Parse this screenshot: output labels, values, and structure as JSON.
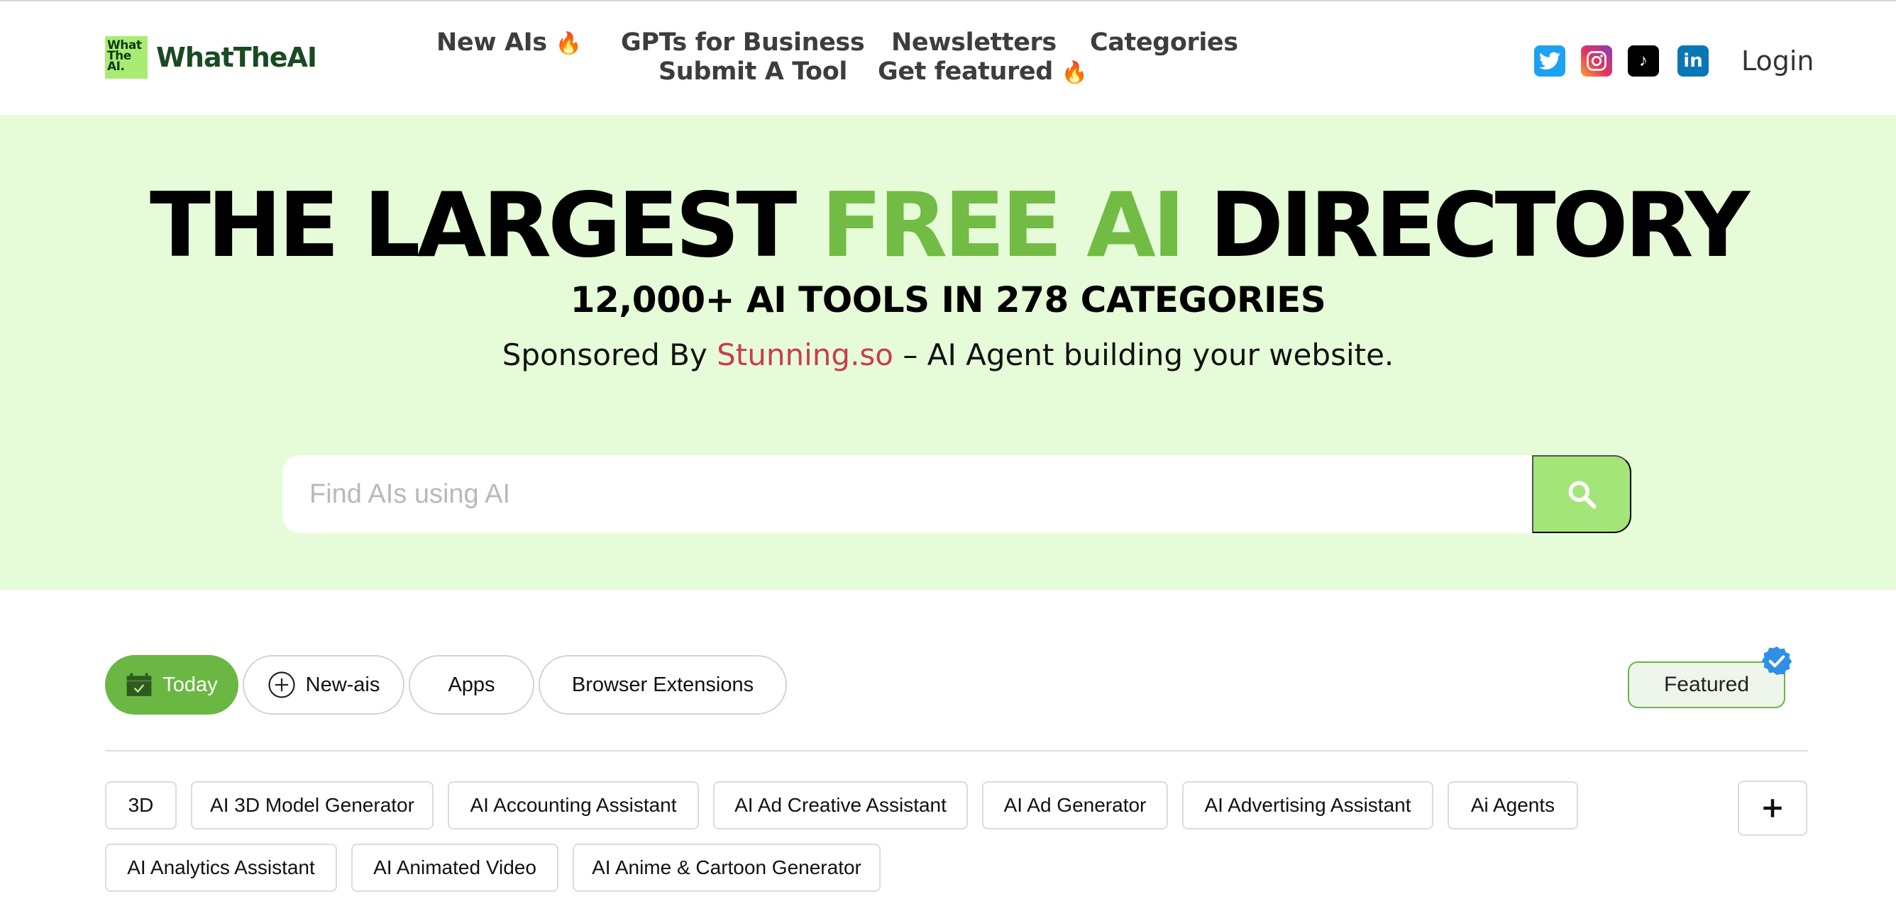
{
  "header": {
    "logo_badge_lines": [
      "What",
      "The",
      "AI."
    ],
    "logo_text": "WhatTheAI",
    "nav": {
      "new_ais": "New AIs",
      "gpts_business": "GPTs for Business",
      "newsletters": "Newsletters",
      "categories": "Categories",
      "submit_tool": "Submit A Tool",
      "get_featured": "Get featured"
    },
    "fire_emoji": "🔥",
    "social": [
      "twitter-icon",
      "instagram-icon",
      "tiktok-icon",
      "linkedin-icon"
    ],
    "linkedin_text": "in",
    "tiktok_glyph": "♪",
    "login": "Login"
  },
  "hero": {
    "title_part1": "THE LARGEST ",
    "title_highlight": "FREE AI",
    "title_part2": " DIRECTORY",
    "subtitle": "12,000+ AI TOOLS IN 278 CATEGORIES",
    "sponsor_prefix": "Sponsored By ",
    "sponsor_brand": "Stunning.so",
    "sponsor_suffix": " – AI Agent building your website.",
    "search_placeholder": "Find AIs using AI"
  },
  "tabs": {
    "today": "Today",
    "new_ais": "New-ais",
    "apps": "Apps",
    "browser_extensions": "Browser Extensions",
    "featured": "Featured"
  },
  "categories": [
    "3D",
    "AI 3D Model Generator",
    "AI Accounting Assistant",
    "AI Ad Creative Assistant",
    "AI Ad Generator",
    "AI Advertising Assistant",
    "Ai Agents",
    "AI Analytics Assistant",
    "AI Animated Video",
    "AI Anime & Cartoon Generator"
  ],
  "colors": {
    "hero_bg": "#e6fcd8",
    "accent_green": "#72bb44",
    "search_button": "#a4e57a",
    "sponsor_brand": "#c93c4f",
    "logo_green": "#1a4a22"
  }
}
